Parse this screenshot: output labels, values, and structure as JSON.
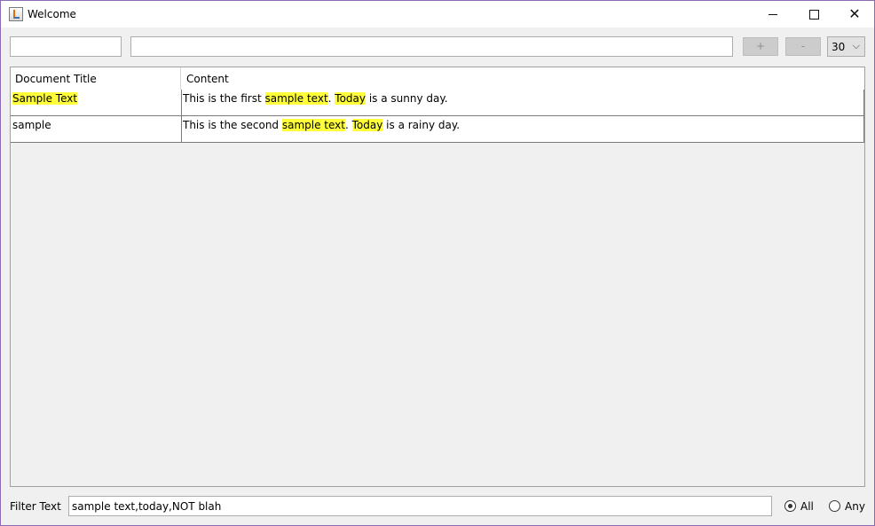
{
  "window": {
    "title": "Welcome",
    "icon": "java-cup-icon",
    "controls": {
      "minimize": "minimize-icon",
      "maximize": "maximize-icon",
      "close": "close-icon",
      "close_glyph": "✕"
    }
  },
  "toolbar": {
    "title_field_value": "",
    "content_field_value": "",
    "add_label": "+",
    "remove_label": "-",
    "font_size_value": "30",
    "chevron_glyph": "⌵"
  },
  "table": {
    "columns": [
      "Document Title",
      "Content"
    ],
    "rows": [
      {
        "title": [
          {
            "text": "Sample Text",
            "highlight": true
          }
        ],
        "content": [
          {
            "text": "This is the first ",
            "highlight": false
          },
          {
            "text": "sample text",
            "highlight": true
          },
          {
            "text": ". ",
            "highlight": false
          },
          {
            "text": "Today",
            "highlight": true
          },
          {
            "text": " is a sunny day.",
            "highlight": false
          }
        ]
      },
      {
        "title": [
          {
            "text": "sample",
            "highlight": false
          }
        ],
        "content": [
          {
            "text": "This is the second ",
            "highlight": false
          },
          {
            "text": "sample text",
            "highlight": true
          },
          {
            "text": ". ",
            "highlight": false
          },
          {
            "text": "Today",
            "highlight": true
          },
          {
            "text": " is a rainy day.",
            "highlight": false
          }
        ]
      }
    ],
    "highlight_color": "#ffff3a"
  },
  "filter": {
    "label": "Filter Text",
    "value": "sample text,today,NOT blah",
    "options": [
      {
        "label": "All",
        "selected": true
      },
      {
        "label": "Any",
        "selected": false
      }
    ]
  }
}
